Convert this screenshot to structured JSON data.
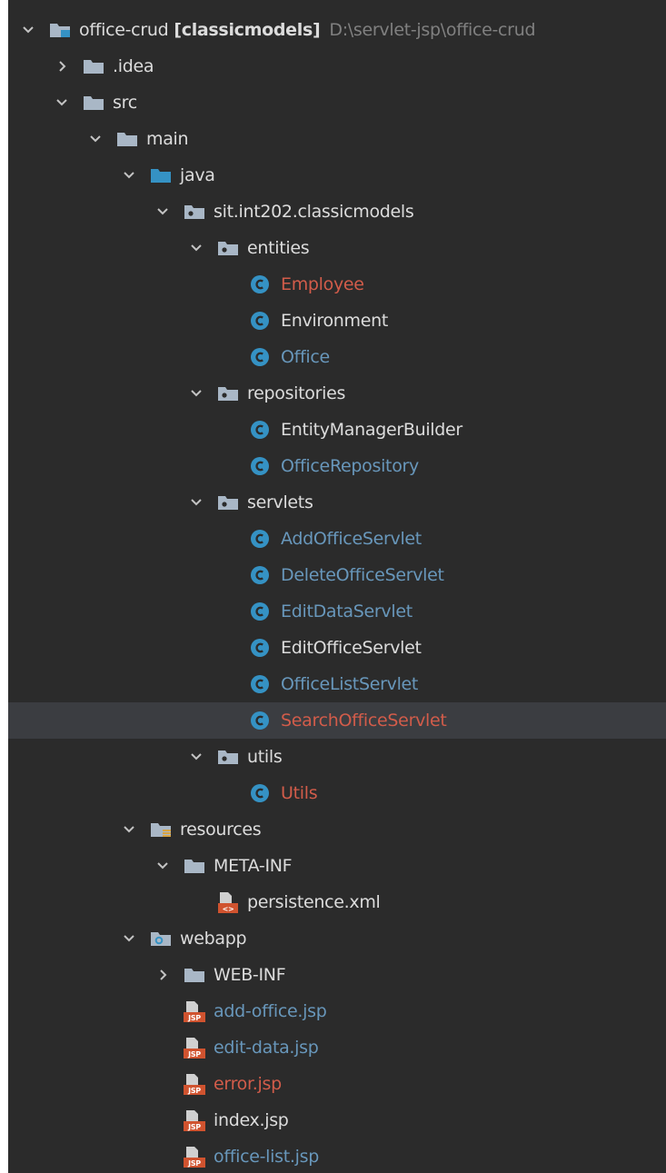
{
  "tree": {
    "project": {
      "name": "office-crud",
      "module": "[classicmodels]",
      "path": "D:\\servlet-jsp\\office-crud"
    },
    "items": [
      {
        "label": "office-crud",
        "depth": 0,
        "arrow": "down",
        "icon": "module-folder-icon",
        "color": "default",
        "project": true
      },
      {
        "label": ".idea",
        "depth": 1,
        "arrow": "right",
        "icon": "folder-icon",
        "color": "default"
      },
      {
        "label": "src",
        "depth": 1,
        "arrow": "down",
        "icon": "folder-icon",
        "color": "default"
      },
      {
        "label": "main",
        "depth": 2,
        "arrow": "down",
        "icon": "folder-icon",
        "color": "default"
      },
      {
        "label": "java",
        "depth": 3,
        "arrow": "down",
        "icon": "source-root-folder-icon",
        "color": "default"
      },
      {
        "label": "sit.int202.classicmodels",
        "depth": 4,
        "arrow": "down",
        "icon": "package-icon",
        "color": "default"
      },
      {
        "label": "entities",
        "depth": 5,
        "arrow": "down",
        "icon": "package-icon",
        "color": "default"
      },
      {
        "label": "Employee",
        "depth": 6,
        "arrow": "none",
        "icon": "class-icon",
        "color": "error"
      },
      {
        "label": "Environment",
        "depth": 6,
        "arrow": "none",
        "icon": "class-icon",
        "color": "default"
      },
      {
        "label": "Office",
        "depth": 6,
        "arrow": "none",
        "icon": "class-icon",
        "color": "modified"
      },
      {
        "label": "repositories",
        "depth": 5,
        "arrow": "down",
        "icon": "package-icon",
        "color": "default"
      },
      {
        "label": "EntityManagerBuilder",
        "depth": 6,
        "arrow": "none",
        "icon": "class-icon",
        "color": "default"
      },
      {
        "label": "OfficeRepository",
        "depth": 6,
        "arrow": "none",
        "icon": "class-icon",
        "color": "modified"
      },
      {
        "label": "servlets",
        "depth": 5,
        "arrow": "down",
        "icon": "package-icon",
        "color": "default"
      },
      {
        "label": "AddOfficeServlet",
        "depth": 6,
        "arrow": "none",
        "icon": "class-icon",
        "color": "modified"
      },
      {
        "label": "DeleteOfficeServlet",
        "depth": 6,
        "arrow": "none",
        "icon": "class-icon",
        "color": "modified"
      },
      {
        "label": "EditDataServlet",
        "depth": 6,
        "arrow": "none",
        "icon": "class-icon",
        "color": "modified"
      },
      {
        "label": "EditOfficeServlet",
        "depth": 6,
        "arrow": "none",
        "icon": "class-icon",
        "color": "default"
      },
      {
        "label": "OfficeListServlet",
        "depth": 6,
        "arrow": "none",
        "icon": "class-icon",
        "color": "modified"
      },
      {
        "label": "SearchOfficeServlet",
        "depth": 6,
        "arrow": "none",
        "icon": "class-icon",
        "color": "error",
        "selected": true
      },
      {
        "label": "utils",
        "depth": 5,
        "arrow": "down",
        "icon": "package-icon",
        "color": "default"
      },
      {
        "label": "Utils",
        "depth": 6,
        "arrow": "none",
        "icon": "class-icon",
        "color": "error"
      },
      {
        "label": "resources",
        "depth": 3,
        "arrow": "down",
        "icon": "resources-root-folder-icon",
        "color": "default"
      },
      {
        "label": "META-INF",
        "depth": 4,
        "arrow": "down",
        "icon": "folder-icon",
        "color": "default"
      },
      {
        "label": "persistence.xml",
        "depth": 5,
        "arrow": "none",
        "icon": "xml-file-icon",
        "color": "default"
      },
      {
        "label": "webapp",
        "depth": 3,
        "arrow": "down",
        "icon": "web-folder-icon",
        "color": "default"
      },
      {
        "label": "WEB-INF",
        "depth": 4,
        "arrow": "right",
        "icon": "folder-icon",
        "color": "default"
      },
      {
        "label": "add-office.jsp",
        "depth": 4,
        "arrow": "none",
        "icon": "jsp-file-icon",
        "color": "modified"
      },
      {
        "label": "edit-data.jsp",
        "depth": 4,
        "arrow": "none",
        "icon": "jsp-file-icon",
        "color": "modified"
      },
      {
        "label": "error.jsp",
        "depth": 4,
        "arrow": "none",
        "icon": "jsp-file-icon",
        "color": "error"
      },
      {
        "label": "index.jsp",
        "depth": 4,
        "arrow": "none",
        "icon": "jsp-file-icon",
        "color": "default"
      },
      {
        "label": "office-list.jsp",
        "depth": 4,
        "arrow": "none",
        "icon": "jsp-file-icon",
        "color": "modified"
      }
    ]
  },
  "colors": {
    "background": "#2b2b2b",
    "selection": "#3b3d41",
    "text_default": "#dcdcdc",
    "text_modified": "#6897bb",
    "text_error": "#d25c4a",
    "text_path": "#808080",
    "folder": "#a9b7c6",
    "source_root": "#3592c4",
    "class_icon": "#3592c4",
    "xml_badge": "#d0532f",
    "jsp_badge": "#d0532f"
  },
  "legend": {
    "file_icons": [
      "ⓒ",
      "JSP",
      "<>"
    ]
  }
}
